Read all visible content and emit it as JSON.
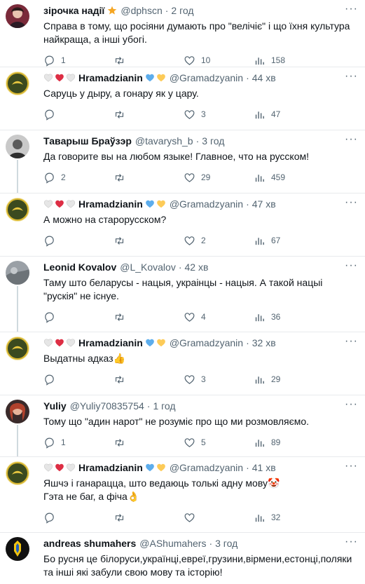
{
  "tweets": [
    {
      "name": "зірочка надії",
      "handle": "@dphscn",
      "time": "2 год",
      "text": "Справа в тому, що росіяни думають про \"велічіє\" і що їхня культура найкраща, а інші убогі.",
      "replies": "1",
      "retweets": "",
      "likes": "10",
      "views": "158"
    },
    {
      "name": "Hramadzianin",
      "handle": "@Gramadzyanin",
      "time": "44 хв",
      "text": "Саруць у дыру, а гонару як у цару.",
      "replies": "",
      "retweets": "",
      "likes": "3",
      "views": "47"
    },
    {
      "name": "Тавaрыш Браўзэр",
      "handle": "@tavarysh_b",
      "time": "3 год",
      "text": "Да говорите вы на любом языке! Главное, что на русском!",
      "replies": "2",
      "retweets": "",
      "likes": "29",
      "views": "459"
    },
    {
      "name": "Hramadzianin",
      "handle": "@Gramadzyanin",
      "time": "47 хв",
      "text": "А можно на старорусском?",
      "replies": "",
      "retweets": "",
      "likes": "2",
      "views": "67"
    },
    {
      "name": "Leonid Kovalov",
      "handle": "@L_Kovalov",
      "time": "42 хв",
      "text": "Таму што беларусы - нацыя, украінцы - нацыя. А такой нацыі \"рускія\" не існуе.",
      "replies": "",
      "retweets": "",
      "likes": "4",
      "views": "36"
    },
    {
      "name": "Hramadzianin",
      "handle": "@Gramadzyanin",
      "time": "32 хв",
      "text": "Выдатны адказ👍",
      "replies": "",
      "retweets": "",
      "likes": "3",
      "views": "29"
    },
    {
      "name": "Yuliy",
      "handle": "@Yuliy70835754",
      "time": "1 год",
      "text": "Тому що \"адин нарот\" не розуміє про що ми розмовляємо.",
      "replies": "1",
      "retweets": "",
      "likes": "5",
      "views": "89"
    },
    {
      "name": "Hramadzianin",
      "handle": "@Gramadzyanin",
      "time": "41 хв",
      "text": "Яшчэ і ганарацца, што ведаюць толькі адну мову🤡\nГэта не баг, а фіча👌",
      "replies": "",
      "retweets": "",
      "likes": "",
      "views": "32"
    },
    {
      "name": "andreas shumahers",
      "handle": "@AShumahers",
      "time": "3 год",
      "text": "Бо русня це білоруси,українці,евреї,грузини,вірмени,естонці,поляки та інші які забули свою мову та історію!",
      "replies": "",
      "retweets": "",
      "likes": "",
      "views": ""
    }
  ],
  "colors": {
    "text": "#0f1419",
    "muted": "#536471",
    "divider": "#e8eaed",
    "thread": "#cfd9de"
  },
  "icons": [
    "reply-icon",
    "retweet-icon",
    "like-icon",
    "views-icon",
    "more-icon"
  ]
}
